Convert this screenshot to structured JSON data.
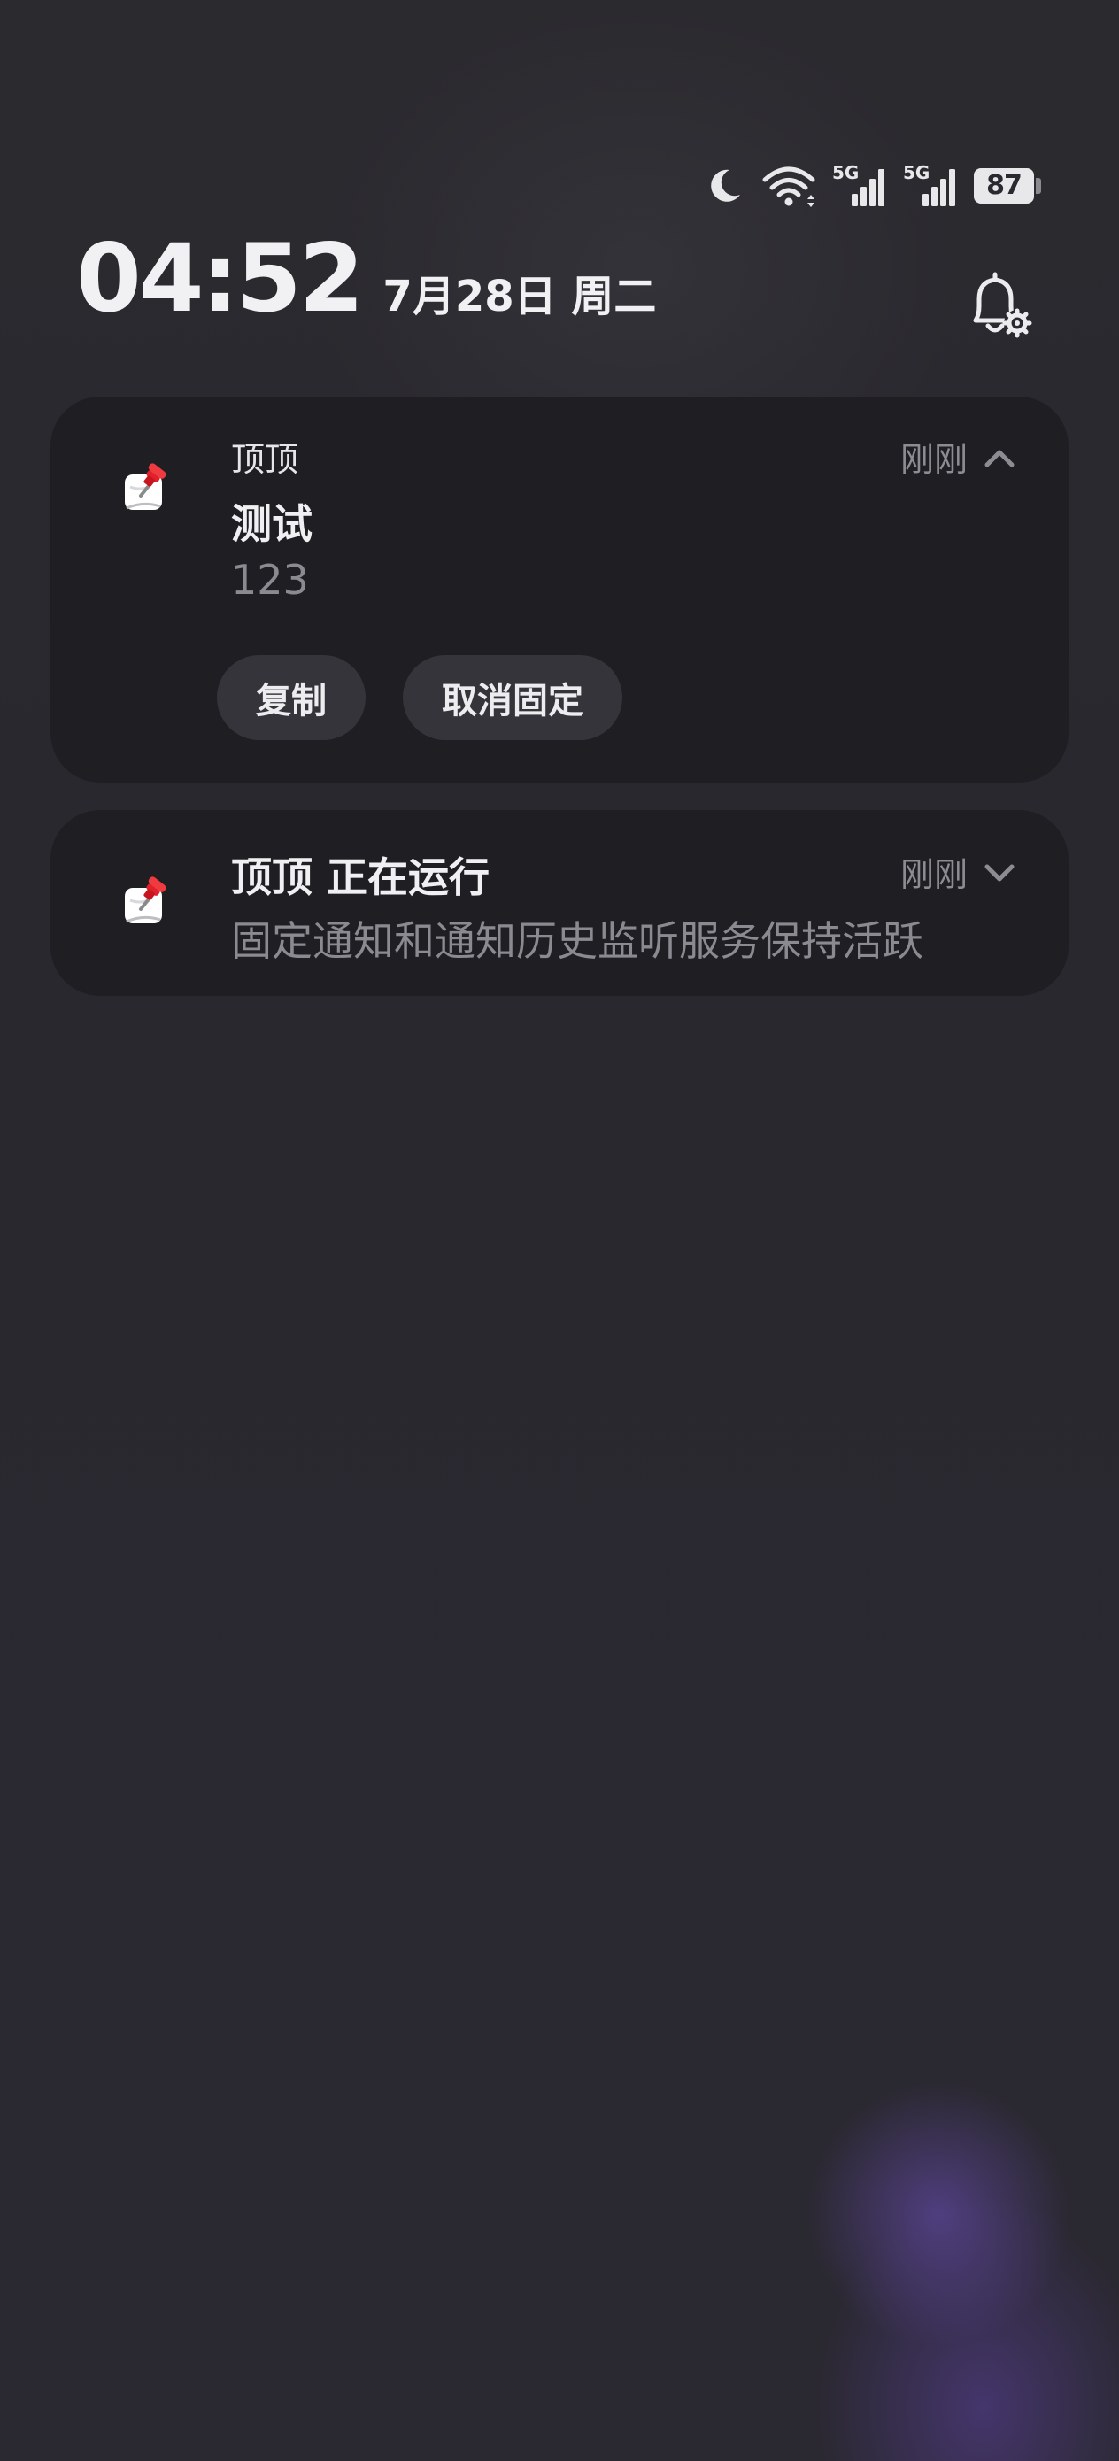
{
  "status_bar": {
    "icons": [
      "moon-icon",
      "wifi-icon",
      "signal-5g-icon",
      "signal-5g-icon"
    ],
    "network_label_1": "5G",
    "network_label_2": "5G",
    "battery": "87"
  },
  "header": {
    "time": "04:52",
    "date": "7月28日 周二",
    "settings_icon": "bell-settings-icon"
  },
  "notifications": [
    {
      "app": "顶顶",
      "time": "刚刚",
      "title": "测试",
      "body": "123",
      "expanded": true,
      "actions": [
        "复制",
        "取消固定"
      ]
    },
    {
      "title": "顶顶 正在运行",
      "time": "刚刚",
      "body": "固定通知和通知历史监听服务保持活跃",
      "expanded": false
    }
  ],
  "colors": {
    "background": "#2a2830",
    "card": "#1f1e23",
    "pill": "#35343a",
    "muted_text": "#8b8a91"
  }
}
